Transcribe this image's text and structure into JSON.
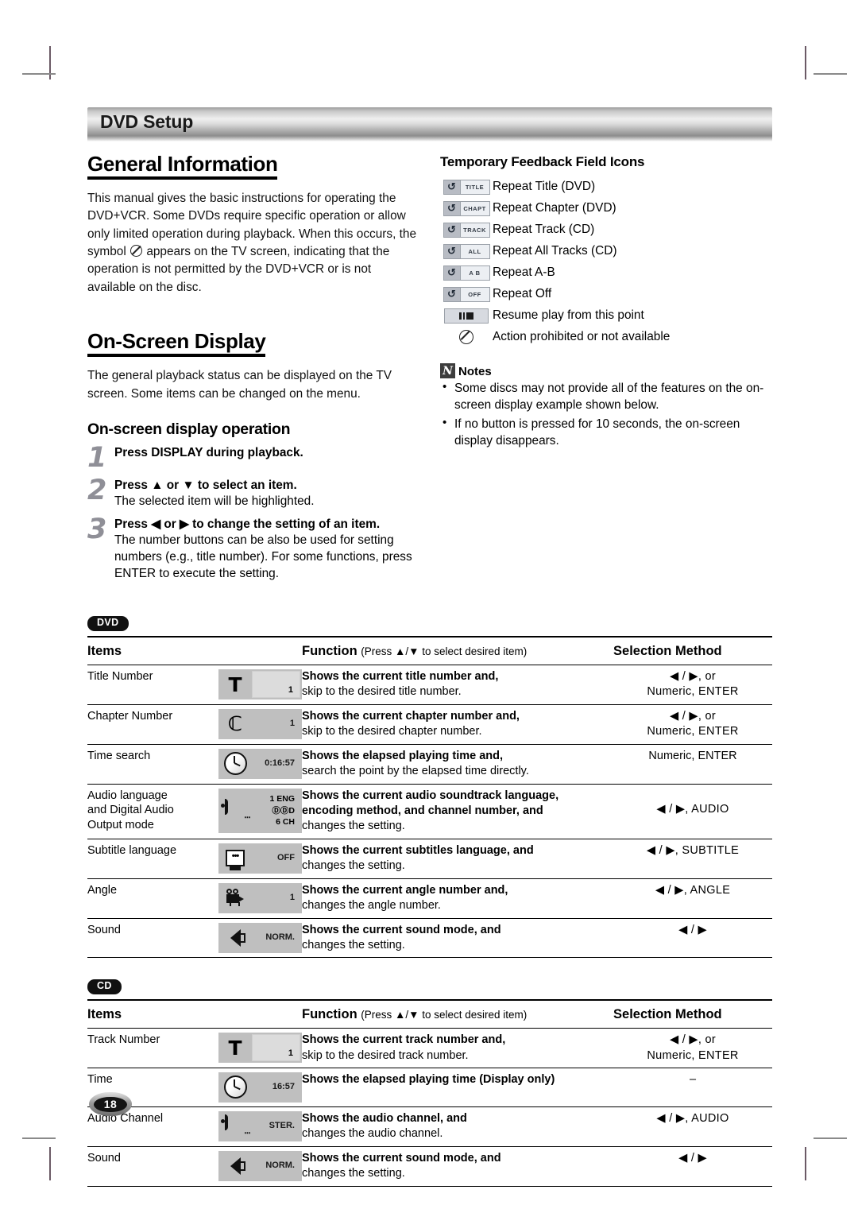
{
  "header": {
    "title": "DVD Setup"
  },
  "left": {
    "general": {
      "heading": "General Information",
      "paragraph_1": "This manual gives the basic instructions for operating the DVD+VCR. Some DVDs require specific operation or allow only limited operation during playback. When this occurs, the symbol",
      "paragraph_2": "appears on the TV screen, indicating that the operation is not permitted by the DVD+VCR or is not available on the disc."
    },
    "osd": {
      "heading": "On-Screen Display",
      "paragraph": "The general playback status can be displayed on the TV screen. Some items can be changed on the menu.",
      "sub_heading": "On-screen display operation",
      "steps": [
        {
          "num": "1",
          "bold": "Press DISPLAY during playback.",
          "normal": ""
        },
        {
          "num": "2",
          "bold": "Press ▲ or ▼ to select an item.",
          "normal": "The selected item will be highlighted."
        },
        {
          "num": "3",
          "bold": "Press ◀ or ▶ to change the setting of an item.",
          "normal": "The number buttons can be also be used for setting numbers (e.g., title number). For some functions, press ENTER to execute the setting."
        }
      ]
    }
  },
  "right": {
    "feedback_heading": "Temporary Feedback Field Icons",
    "feedback_items": [
      {
        "icon": "repeat-title-icon",
        "chip": "TITLE",
        "label": "Repeat Title (DVD)"
      },
      {
        "icon": "repeat-chapter-icon",
        "chip": "CHAPT",
        "label": "Repeat Chapter (DVD)"
      },
      {
        "icon": "repeat-track-icon",
        "chip": "TRACK",
        "label": "Repeat Track (CD)"
      },
      {
        "icon": "repeat-all-icon",
        "chip": "ALL",
        "label": "Repeat All Tracks (CD)"
      },
      {
        "icon": "repeat-ab-icon",
        "chip": "A  B",
        "label": "Repeat A-B"
      },
      {
        "icon": "repeat-off-icon",
        "chip": "OFF",
        "label": "Repeat Off"
      },
      {
        "icon": "resume-play-icon",
        "chip": "",
        "label": "Resume play from this point"
      },
      {
        "icon": "prohibited-icon",
        "chip": "",
        "label": "Action prohibited or not available"
      }
    ],
    "notes": {
      "badge": "N",
      "label": "Notes",
      "items": [
        "Some discs may not provide all of the features on the on-screen display example shown below.",
        "If no button is pressed for 10 seconds, the on-screen display disappears."
      ]
    }
  },
  "tables": [
    {
      "badge": "DVD",
      "headers": {
        "items": "Items",
        "function_bold": "Function",
        "function_light": "(Press ▲/▼ to select desired item)",
        "selection": "Selection Method"
      },
      "rows": [
        {
          "item": "Title Number",
          "icon": "title-number-osd-icon",
          "icon_glyph": "T",
          "icon_value": "1",
          "icon_style": "box",
          "func_bold": "Shows the current title number and,",
          "func_normal": "skip to the desired title number.",
          "selection": "◀ / ▶, or\nNumeric, ENTER"
        },
        {
          "item": "Chapter Number",
          "icon": "chapter-number-osd-icon",
          "icon_glyph": "C",
          "icon_value": "1",
          "icon_style": "plain",
          "func_bold": "Shows the current chapter number and,",
          "func_normal": "skip to the desired chapter number.",
          "selection": "◀ / ▶, or\nNumeric, ENTER"
        },
        {
          "item": "Time search",
          "icon": "time-search-osd-icon",
          "icon_glyph": "clock",
          "icon_value": "0:16:57",
          "icon_style": "plain",
          "func_bold": "Shows the elapsed playing time and,",
          "func_normal": "search the point by the elapsed time directly.",
          "selection": "Numeric, ENTER"
        },
        {
          "item": "Audio language\nand Digital Audio\nOutput mode",
          "icon": "audio-language-osd-icon",
          "icon_glyph": "audio",
          "icon_value": "1  ENG\nⒹⒹD\n6  CH",
          "icon_style": "multi",
          "func_bold": "Shows the current audio soundtrack language,\nencoding method, and channel number, and",
          "func_normal": "changes the setting.",
          "selection": "◀ / ▶, AUDIO"
        },
        {
          "item": "Subtitle language",
          "icon": "subtitle-language-osd-icon",
          "icon_glyph": "subtitle",
          "icon_value": "OFF",
          "icon_style": "plain",
          "func_bold": "Shows the current subtitles language, and",
          "func_normal": "changes the setting.",
          "selection": "◀ / ▶, SUBTITLE"
        },
        {
          "item": "Angle",
          "icon": "angle-osd-icon",
          "icon_glyph": "camera",
          "icon_value": "1",
          "icon_style": "plain",
          "func_bold": "Shows the current angle number and,",
          "func_normal": "changes the angle number.",
          "selection": "◀ / ▶, ANGLE"
        },
        {
          "item": "Sound",
          "icon": "sound-osd-icon",
          "icon_glyph": "speaker",
          "icon_value": "NORM.",
          "icon_style": "plain",
          "func_bold": "Shows the current sound mode, and",
          "func_normal": "changes the setting.",
          "selection": "◀ / ▶"
        }
      ]
    },
    {
      "badge": "CD",
      "headers": {
        "items": "Items",
        "function_bold": "Function",
        "function_light": "(Press ▲/▼ to select desired item)",
        "selection": "Selection Method"
      },
      "rows": [
        {
          "item": "Track Number",
          "icon": "track-number-osd-icon",
          "icon_glyph": "T",
          "icon_value": "1",
          "icon_style": "box",
          "func_bold": "Shows the current track number and,",
          "func_normal": "skip to the desired track number.",
          "selection": "◀ / ▶, or\nNumeric, ENTER"
        },
        {
          "item": "Time",
          "icon": "time-osd-icon",
          "icon_glyph": "clock",
          "icon_value": "16:57",
          "icon_style": "plain",
          "func_bold": "Shows the elapsed playing time (Display only)",
          "func_normal": "",
          "selection": "–"
        },
        {
          "item": "Audio Channel",
          "icon": "audio-channel-osd-icon",
          "icon_glyph": "audio",
          "icon_value": "STER.",
          "icon_style": "plain",
          "func_bold": "Shows the audio channel, and",
          "func_normal": "changes the audio channel.",
          "selection": "◀ / ▶, AUDIO"
        },
        {
          "item": "Sound",
          "icon": "sound-cd-osd-icon",
          "icon_glyph": "speaker",
          "icon_value": "NORM.",
          "icon_style": "plain",
          "func_bold": "Shows the current sound mode, and",
          "func_normal": "changes the setting.",
          "selection": "◀ / ▶"
        }
      ]
    }
  ],
  "footer": {
    "page_number": "18"
  }
}
